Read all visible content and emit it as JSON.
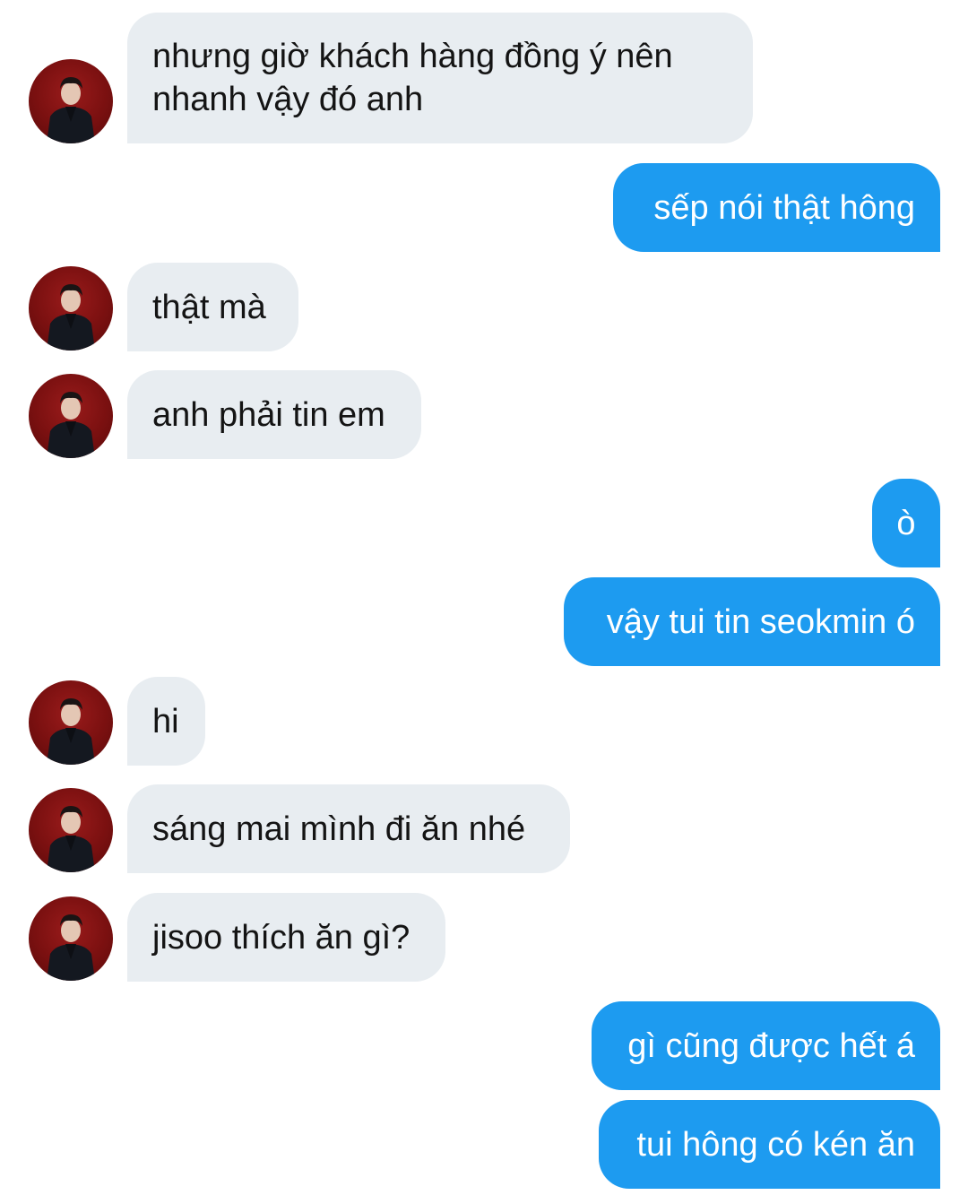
{
  "messages": [
    {
      "from": "other",
      "text": "nhưng giờ khách hàng đồng ý nên\nnhanh vậy đó anh"
    },
    {
      "from": "me",
      "text": "sếp nói thật hông"
    },
    {
      "from": "other",
      "text": "thật mà"
    },
    {
      "from": "other",
      "text": "anh phải tin em"
    },
    {
      "from": "me",
      "text": "ò"
    },
    {
      "from": "me",
      "text": "vậy tui tin seokmin ó"
    },
    {
      "from": "other",
      "text": "hi"
    },
    {
      "from": "other",
      "text": "sáng mai mình đi ăn nhé"
    },
    {
      "from": "other",
      "text": "jisoo thích ăn gì?"
    },
    {
      "from": "me",
      "text": "gì cũng được hết á"
    },
    {
      "from": "me",
      "text": "tui hông có kén ăn"
    }
  ],
  "colors": {
    "incoming_bubble": "#e8edf1",
    "outgoing_bubble": "#1d9bf0",
    "avatar_background": "#7a1010"
  },
  "avatar_icon": "profile-photo-icon"
}
